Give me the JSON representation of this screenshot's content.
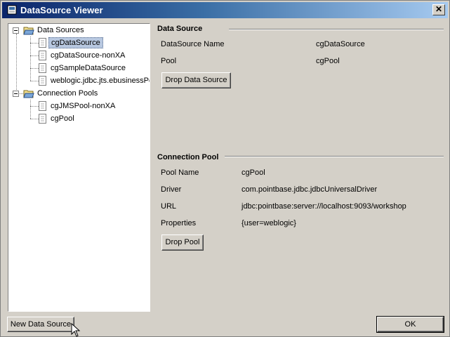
{
  "window": {
    "title": "DataSource Viewer",
    "close_glyph": "✕"
  },
  "tree": {
    "data_sources": {
      "label": "Data Sources",
      "items": [
        {
          "label": "cgDataSource",
          "selected": true
        },
        {
          "label": "cgDataSource-nonXA"
        },
        {
          "label": "cgSampleDataSource"
        },
        {
          "label": "weblogic.jdbc.jts.ebusinessPool"
        }
      ]
    },
    "connection_pools": {
      "label": "Connection Pools",
      "items": [
        {
          "label": "cgJMSPool-nonXA"
        },
        {
          "label": "cgPool"
        }
      ]
    }
  },
  "datasource_section": {
    "title": "Data Source",
    "name_label": "DataSource Name",
    "name_value": "cgDataSource",
    "pool_label": "Pool",
    "pool_value": "cgPool",
    "drop_button": "Drop Data Source"
  },
  "pool_section": {
    "title": "Connection Pool",
    "pool_name_label": "Pool Name",
    "pool_name_value": "cgPool",
    "driver_label": "Driver",
    "driver_value": "com.pointbase.jdbc.jdbcUniversalDriver",
    "url_label": "URL",
    "url_value": "jdbc:pointbase:server://localhost:9093/workshop",
    "properties_label": "Properties",
    "properties_value": "{user=weblogic}",
    "drop_button": "Drop Pool"
  },
  "footer": {
    "new_button": "New Data Source",
    "ok_button": "OK"
  }
}
